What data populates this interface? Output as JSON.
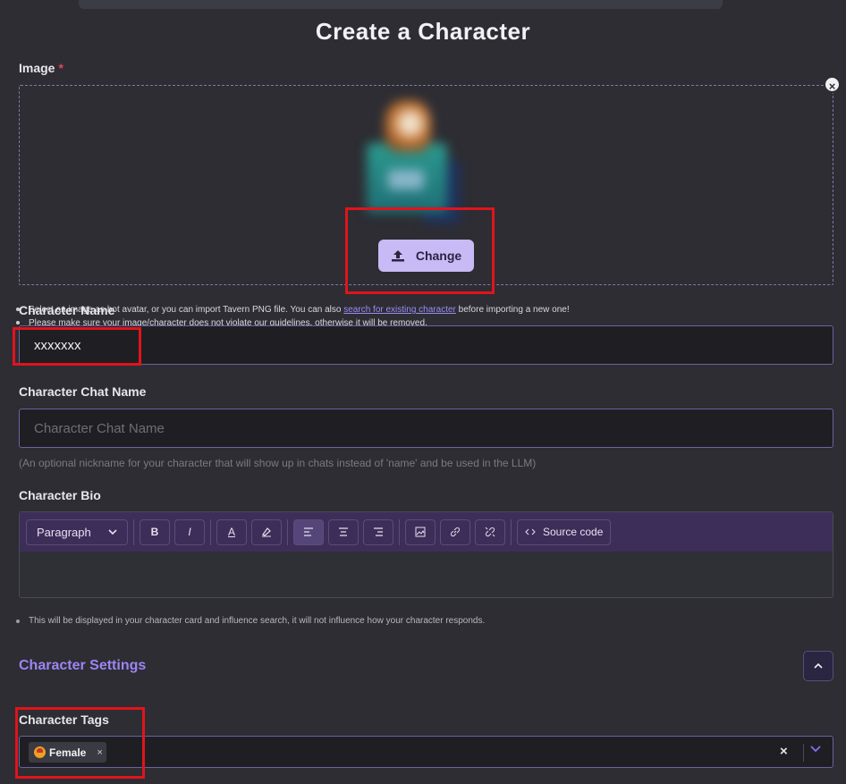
{
  "page": {
    "title": "Create a Character"
  },
  "image_field": {
    "label": "Image",
    "required_mark": "*",
    "clear_icon": "close-icon",
    "change_button": {
      "label": "Change",
      "icon": "upload-icon"
    },
    "notes": [
      {
        "before_link": "Select an image as bot avatar, or you can import Tavern PNG file. You can also ",
        "link": "search for existing character",
        "after_link": " before importing a new one!"
      },
      {
        "text": "Please make sure your image/character does not violate our guidelines, otherwise it will be removed."
      }
    ]
  },
  "name_field": {
    "label": "Character Name",
    "value": "xxxxxxx"
  },
  "chat_name_field": {
    "label": "Character Chat Name",
    "placeholder": "Character Chat Name",
    "hint": "(An optional nickname for your character that will show up in chats instead of 'name' and be used in the LLM)"
  },
  "bio_field": {
    "label": "Character Bio",
    "toolbar": {
      "block_format": "Paragraph",
      "bold": "B",
      "italic": "I",
      "text_color": "A",
      "source_code": "Source code"
    },
    "note": "This will be displayed in your character card and influence search, it will not influence how your character responds."
  },
  "settings": {
    "title": "Character Settings",
    "toggle_icon": "chevron-up-icon"
  },
  "tags_field": {
    "label": "Character Tags",
    "tags": [
      {
        "label": "Female",
        "remove": "×"
      }
    ],
    "clear": "×"
  },
  "colors": {
    "background": "#2d2d33",
    "accent": "#9e84f4",
    "button": "#c8baf5",
    "toolbar": "#3d2e59",
    "highlight": "#e0141c"
  }
}
